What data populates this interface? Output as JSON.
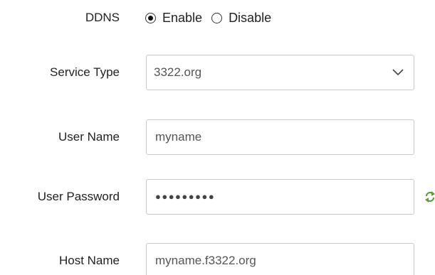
{
  "ddns": {
    "label": "DDNS",
    "options": [
      {
        "label": "Enable",
        "selected": true
      },
      {
        "label": "Disable",
        "selected": false
      }
    ]
  },
  "service_type": {
    "label": "Service Type",
    "value": "3322.org",
    "icon": "chevron-down-icon"
  },
  "user_name": {
    "label": "User Name",
    "value": "myname"
  },
  "user_password": {
    "label": "User Password",
    "masked_value": "●●●●●●●●●",
    "icon": "refresh-icon",
    "icon_color": "#5aa02c"
  },
  "host_name": {
    "label": "Host Name",
    "value": "myname.f3322.org"
  }
}
